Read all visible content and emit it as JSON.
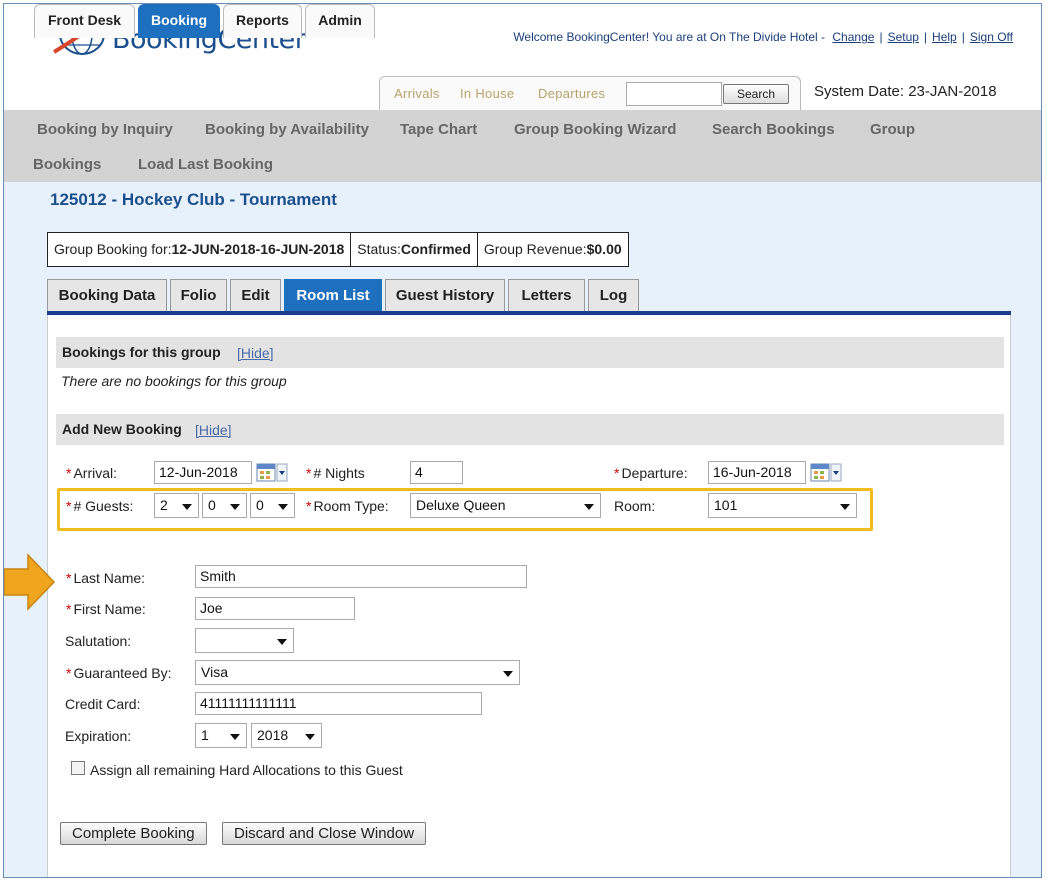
{
  "header": {
    "brand": "BookingCenter",
    "welcome_text": "Welcome BookingCenter! You are at On The Divide Hotel -",
    "links": {
      "change": "Change",
      "setup": "Setup",
      "help": "Help",
      "signoff": "Sign Off"
    },
    "separator": "|"
  },
  "top_tabs": [
    "Front Desk",
    "Booking",
    "Reports",
    "Admin"
  ],
  "active_top_tab": "Booking",
  "quick_links": {
    "arrivals": "Arrivals",
    "in_house": "In House",
    "departures": "Departures"
  },
  "search": {
    "value": "",
    "button": "Search"
  },
  "system_date": "System Date: 23-JAN-2018",
  "menu": {
    "inquiry": "Booking by Inquiry",
    "availability": "Booking by Availability",
    "tape": "Tape Chart",
    "wizard": "Group Booking Wizard",
    "search": "Search Bookings",
    "group": "Group",
    "bookings": "Bookings",
    "last": "Load Last Booking"
  },
  "group": {
    "title": "125012 - Hockey Club - Tournament",
    "for_label": "Group Booking for:",
    "for_value": "12-JUN-2018-16-JUN-2018",
    "status_label": "Status:",
    "status_value": "Confirmed",
    "revenue_label": "Group Revenue:",
    "revenue_value": "$0.00"
  },
  "content_tabs": [
    "Booking Data",
    "Folio",
    "Edit",
    "Room List",
    "Guest History",
    "Letters",
    "Log"
  ],
  "active_content_tab": "Room List",
  "bookings_section": {
    "title": "Bookings for this group",
    "hide": "[Hide]",
    "empty": "There are no bookings for this group"
  },
  "add_section": {
    "title": "Add New Booking",
    "hide": "[Hide]"
  },
  "form": {
    "required_mark": "*",
    "arrival": {
      "label": "Arrival:",
      "value": "12-Jun-2018"
    },
    "nights": {
      "label": "# Nights",
      "value": "4"
    },
    "departure": {
      "label": "Departure:",
      "value": "16-Jun-2018"
    },
    "guests": {
      "label": "# Guests:",
      "adults": "2",
      "children": "0",
      "infants": "0"
    },
    "room_type": {
      "label": "Room Type:",
      "value": "Deluxe Queen"
    },
    "room": {
      "label": "Room:",
      "value": "101"
    },
    "last_name": {
      "label": "Last Name:",
      "value": "Smith"
    },
    "first_name": {
      "label": "First Name:",
      "value": "Joe"
    },
    "salutation": {
      "label": "Salutation:",
      "value": ""
    },
    "guaranteed_by": {
      "label": "Guaranteed By:",
      "value": "Visa"
    },
    "credit_card": {
      "label": "Credit Card:",
      "value": "41111111111111"
    },
    "expiration": {
      "label": "Expiration:",
      "month": "1",
      "year": "2018"
    },
    "assign_label": "Assign all remaining Hard Allocations to this Guest"
  },
  "buttons": {
    "complete": "Complete Booking",
    "discard": "Discard and Close Window"
  },
  "colors": {
    "brand_blue": "#1f6fbf",
    "highlight": "#f0bc1f",
    "arrow": "#f0a51f",
    "title_blue": "#1b4f8e"
  }
}
